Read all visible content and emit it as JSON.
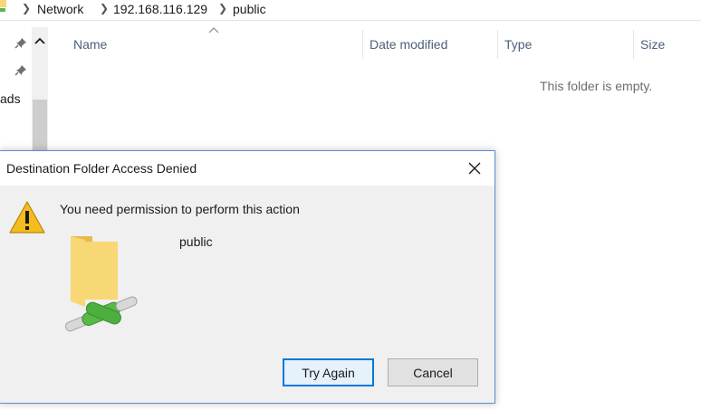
{
  "address": {
    "crumbs": [
      "Network",
      "192.168.116.129",
      "public"
    ]
  },
  "nav": {
    "partial_label": "ads"
  },
  "columns": {
    "name": "Name",
    "date_modified": "Date modified",
    "type": "Type",
    "size": "Size"
  },
  "content": {
    "empty_message": "This folder is empty."
  },
  "dialog": {
    "title": "Destination Folder Access Denied",
    "message": "You need permission to perform this action",
    "folder_name": "public",
    "try_again_label": "Try Again",
    "cancel_label": "Cancel"
  },
  "colors": {
    "accent": "#0078d7",
    "warning": "#f4bc1c",
    "folder": "#f8d775",
    "network_green": "#59b947"
  },
  "icons": [
    "network-icon",
    "pin-icon",
    "sort-up-icon",
    "close-icon",
    "warning-icon",
    "network-folder-icon"
  ]
}
